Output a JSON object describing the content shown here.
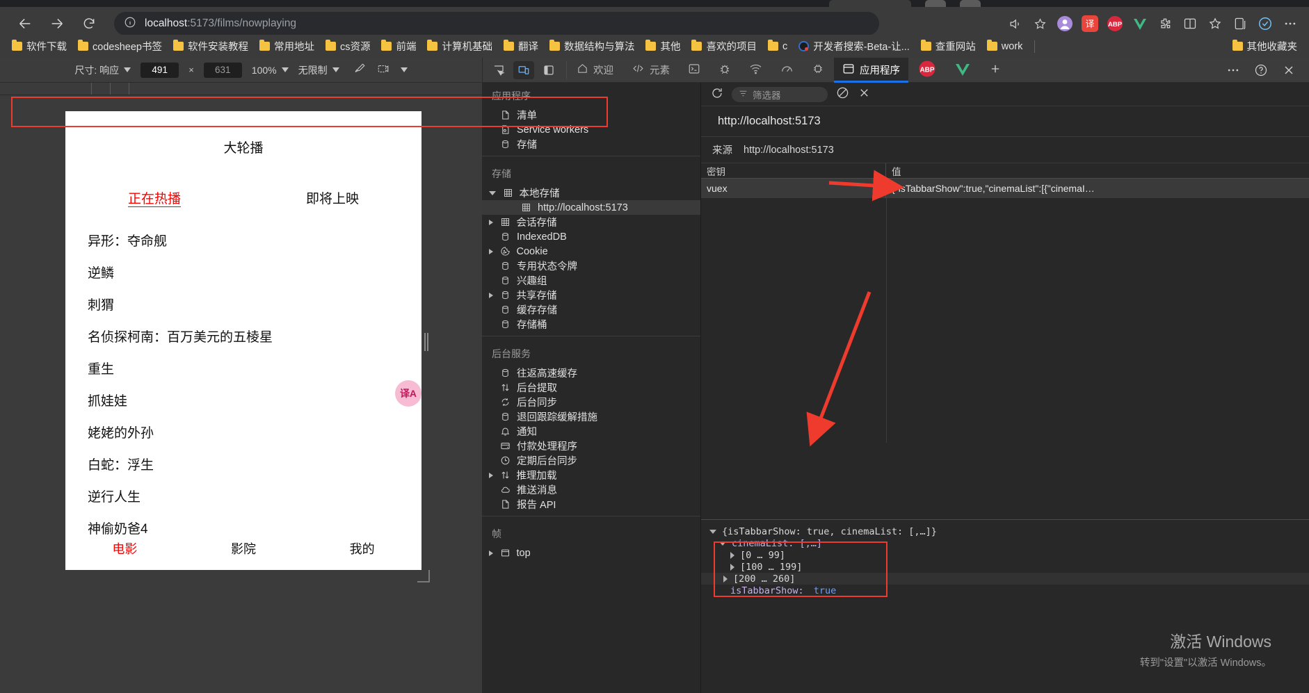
{
  "browser": {
    "nav": {
      "back_label": "Back",
      "forward_label": "Forward",
      "reload_label": "Reload",
      "info_label": "Site information",
      "url_host": "localhost",
      "url_path": ":5173/films/nowplaying",
      "read_aloud_label": "Read aloud",
      "favorite_label": "Add to favorites"
    },
    "bookmarks": [
      {
        "label": "软件下载",
        "icon": "folder-icon"
      },
      {
        "label": "codesheep书签",
        "icon": "folder-icon"
      },
      {
        "label": "软件安装教程",
        "icon": "folder-icon"
      },
      {
        "label": "常用地址",
        "icon": "folder-icon"
      },
      {
        "label": "cs资源",
        "icon": "folder-icon"
      },
      {
        "label": "前端",
        "icon": "folder-icon"
      },
      {
        "label": "计算机基础",
        "icon": "folder-icon"
      },
      {
        "label": "翻译",
        "icon": "folder-icon"
      },
      {
        "label": "数据结构与算法",
        "icon": "folder-icon"
      },
      {
        "label": "其他",
        "icon": "folder-icon"
      },
      {
        "label": "喜欢的项目",
        "icon": "folder-icon"
      },
      {
        "label": "c",
        "icon": "folder-icon"
      },
      {
        "label": "开发者搜索-Beta-让...",
        "icon": "globe-icon"
      },
      {
        "label": "查重网站",
        "icon": "folder-icon"
      },
      {
        "label": "work",
        "icon": "folder-icon"
      }
    ],
    "bookmarks_overflow": {
      "label": "其他收藏夹",
      "icon": "folder-icon"
    }
  },
  "emulation": {
    "size_label": "尺寸: 响应",
    "width": "491",
    "height": "631",
    "x_symbol": "×",
    "zoom": "100%",
    "throttling": "无限制"
  },
  "devtools": {
    "device_buttons": [
      {
        "name": "inspect-element",
        "active": false
      },
      {
        "name": "device-toolbar",
        "active": true
      },
      {
        "name": "dock-side",
        "active": false
      }
    ],
    "tabs": [
      {
        "label": "欢迎",
        "icon": "home-icon",
        "active": false
      },
      {
        "label": "元素",
        "icon": "code-icon",
        "active": false
      },
      {
        "label": "",
        "icon": "console-icon",
        "active": false
      },
      {
        "label": "",
        "icon": "sources-bug-icon",
        "active": false
      },
      {
        "label": "",
        "icon": "network-icon",
        "active": false
      },
      {
        "label": "",
        "icon": "performance-icon",
        "active": false
      },
      {
        "label": "",
        "icon": "memory-chip-icon",
        "active": false
      },
      {
        "label": "应用程序",
        "icon": "application-icon",
        "active": true
      }
    ],
    "extensions": [
      {
        "label": "ABP",
        "name": "adblock-plus-icon"
      },
      {
        "label": "V",
        "name": "vue-devtools-icon"
      }
    ],
    "more_label": "⋯",
    "help_label": "?",
    "close_label": "✕"
  },
  "page": {
    "title": "大轮播",
    "tabs": [
      {
        "label": "正在热播",
        "active": true
      },
      {
        "label": "即将上映",
        "active": false
      }
    ],
    "films": [
      "异形：夺命舰",
      "逆鳞",
      "刺猬",
      "名侦探柯南：百万美元的五棱星",
      "重生",
      "抓娃娃",
      "姥姥的外孙",
      "白蛇：浮生",
      "逆行人生",
      "神偷奶爸4"
    ],
    "tabbar": [
      {
        "label": "电影",
        "active": true
      },
      {
        "label": "影院",
        "active": false
      },
      {
        "label": "我的",
        "active": false
      }
    ],
    "translate_fab": "译A"
  },
  "app_sidebar": {
    "section_application": {
      "title": "应用程序",
      "items": [
        {
          "label": "清单",
          "icon": "manifest-file-icon"
        },
        {
          "label": "Service workers",
          "icon": "service-worker-icon"
        },
        {
          "label": "存储",
          "icon": "database-icon"
        }
      ]
    },
    "section_storage": {
      "title": "存储",
      "items": [
        {
          "label": "本地存储",
          "icon": "table-icon",
          "expanded": true,
          "expandable": true,
          "children": [
            {
              "label": "http://localhost:5173",
              "icon": "table-icon",
              "selected": true
            }
          ]
        },
        {
          "label": "会话存储",
          "icon": "table-icon",
          "expandable": true,
          "expanded": false
        },
        {
          "label": "IndexedDB",
          "icon": "database-icon",
          "expandable": false
        },
        {
          "label": "Cookie",
          "icon": "cookie-icon",
          "expandable": true,
          "expanded": false
        },
        {
          "label": "专用状态令牌",
          "icon": "database-icon",
          "expandable": false
        },
        {
          "label": "兴趣组",
          "icon": "database-icon",
          "expandable": false
        },
        {
          "label": "共享存储",
          "icon": "database-icon",
          "expandable": true,
          "expanded": false
        },
        {
          "label": "缓存存储",
          "icon": "database-icon",
          "expandable": false
        },
        {
          "label": "存储桶",
          "icon": "database-icon",
          "expandable": false
        }
      ]
    },
    "section_background": {
      "title": "后台服务",
      "items": [
        {
          "label": "往返高速缓存",
          "icon": "database-icon",
          "expandable": false
        },
        {
          "label": "后台提取",
          "icon": "arrows-updown-icon",
          "expandable": false
        },
        {
          "label": "后台同步",
          "icon": "sync-icon",
          "expandable": false
        },
        {
          "label": "退回跟踪缓解措施",
          "icon": "database-icon",
          "expandable": false
        },
        {
          "label": "通知",
          "icon": "bell-icon",
          "expandable": false
        },
        {
          "label": "付款处理程序",
          "icon": "payment-card-icon",
          "expandable": false
        },
        {
          "label": "定期后台同步",
          "icon": "clock-icon",
          "expandable": false
        },
        {
          "label": "推理加载",
          "icon": "arrows-updown-icon",
          "expandable": true,
          "expanded": false
        },
        {
          "label": "推送消息",
          "icon": "cloud-icon",
          "expandable": false
        },
        {
          "label": "报告 API",
          "icon": "report-file-icon",
          "expandable": false
        }
      ]
    },
    "section_frames": {
      "title": "帧",
      "items": [
        {
          "label": "top",
          "icon": "frame-icon",
          "expandable": true,
          "expanded": false
        }
      ]
    }
  },
  "storage_view": {
    "toolbar": {
      "refresh_label": "刷新",
      "filter_placeholder": "筛选器",
      "clear_all_label": "清除全部",
      "delete_label": "删除所选"
    },
    "origin_heading": "http://localhost:5173",
    "source_label": "来源",
    "source_value": "http://localhost:5173",
    "columns": [
      "密钥",
      "值"
    ],
    "rows": [
      {
        "key": "vuex",
        "value": "{\"isTabbarShow\":true,\"cinemaList\":[{\"cinemaI…"
      }
    ]
  },
  "preview": {
    "lines": [
      {
        "indent": 0,
        "toggle": "open",
        "text": "{isTabbarShow: true, cinemaList: [,…]}",
        "kind": "plain"
      },
      {
        "indent": 1,
        "toggle": "open",
        "text": "cinemaList: [,…]",
        "kind": "key"
      },
      {
        "indent": 2,
        "toggle": "closed",
        "text": "[0 … 99]",
        "kind": "plain"
      },
      {
        "indent": 2,
        "toggle": "closed",
        "text": "[100 … 199]",
        "kind": "plain"
      },
      {
        "indent": 2,
        "toggle": "closed",
        "text": "[200 … 260]",
        "kind": "plain",
        "highlighted": true
      },
      {
        "indent": 2,
        "toggle": "none",
        "text": "isTabbarShow: ",
        "value": "true",
        "kind": "keybool"
      }
    ]
  },
  "watermark": {
    "line1": "激活 Windows",
    "line2": "转到\"设置\"以激活 Windows。"
  },
  "colors": {
    "accent": "#1a73e8",
    "annotation_red": "#ef3b2d",
    "page_red": "#ff0000",
    "bookmark_folder": "#f5c242"
  }
}
